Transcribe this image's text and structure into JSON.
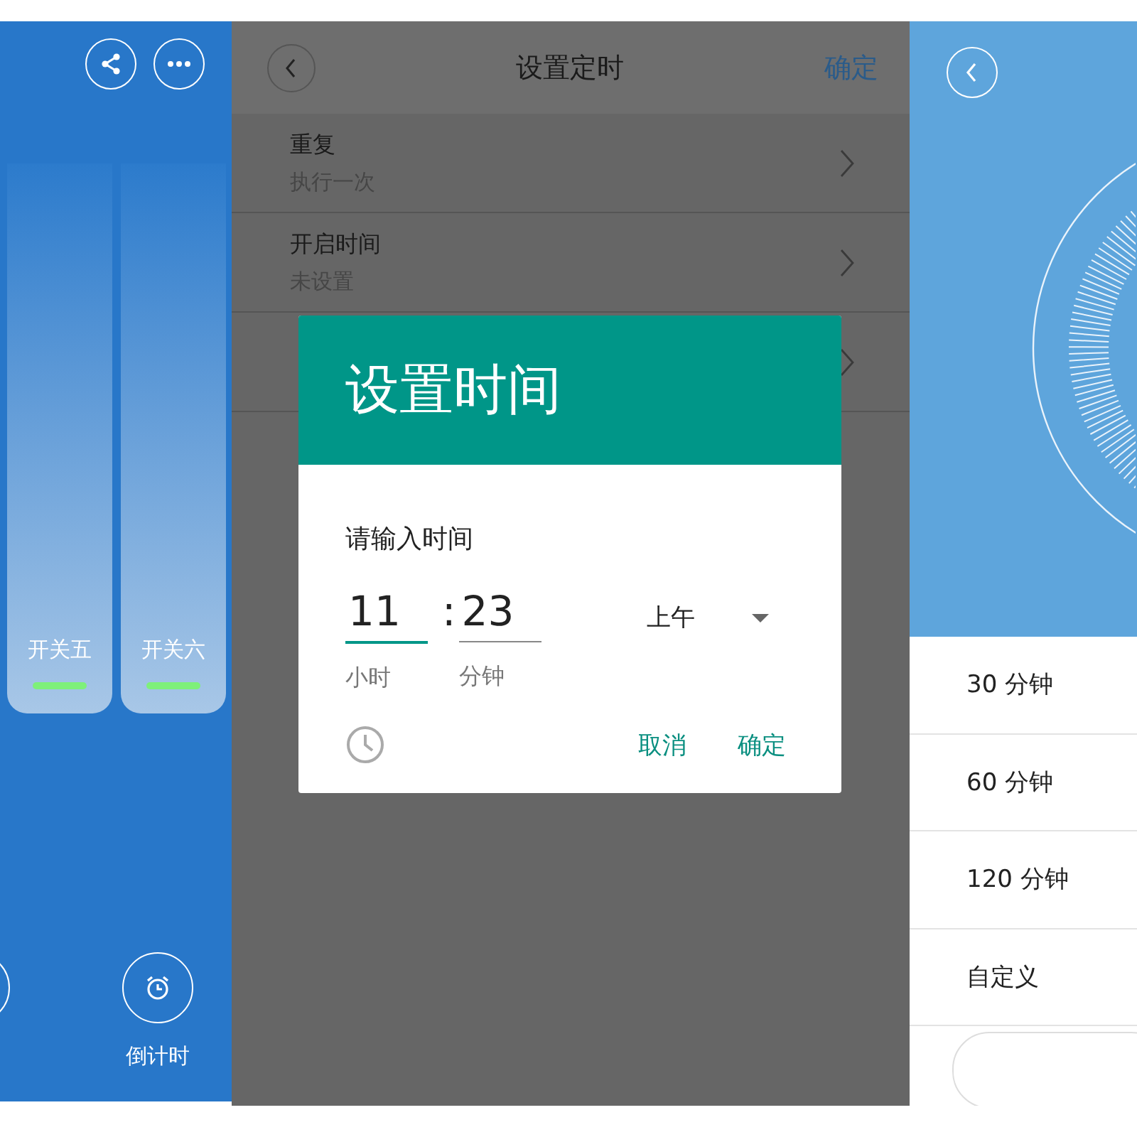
{
  "left_screen": {
    "switches": [
      {
        "label": "开关五",
        "on": true
      },
      {
        "label": "开关六",
        "on": true
      }
    ],
    "countdown_label": "倒计时"
  },
  "middle_screen": {
    "title": "设置定时",
    "confirm": "确定",
    "rows": [
      {
        "title": "重复",
        "value": "执行一次"
      },
      {
        "title": "开启时间",
        "value": "未设置"
      },
      {}
    ],
    "dialog": {
      "title": "设置时间",
      "prompt": "请输入时间",
      "hour": {
        "value": "11",
        "focused": true,
        "label": "小时"
      },
      "separator": ":",
      "minute": {
        "value": "23",
        "focused": false,
        "label": "分钟"
      },
      "period": "上午",
      "cancel": "取消",
      "ok": "确定"
    }
  },
  "right_screen": {
    "options": [
      "30 分钟",
      "60 分钟",
      "120 分钟",
      "自定义"
    ]
  }
}
